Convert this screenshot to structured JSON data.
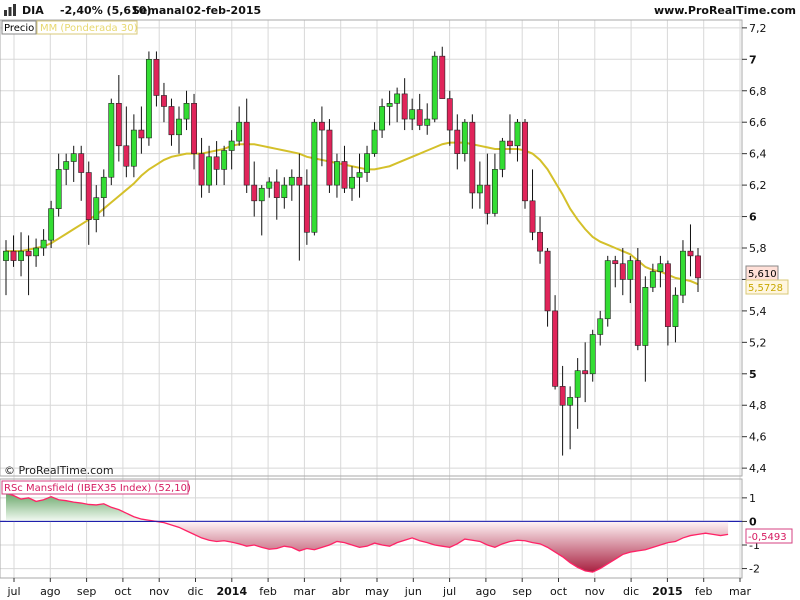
{
  "header": {
    "symbol": "DIA",
    "change": "-2,40% (5,610)",
    "timeframe": "Semanal",
    "date": "02-feb-2015",
    "site": "www.ProRealTime.com"
  },
  "price_panel": {
    "label_precio": "Precio",
    "label_ma": "MM (Ponderada 30)",
    "copyright": "© ProRealTime.com",
    "last_price": "5,610",
    "last_ma": "5,5728"
  },
  "rsc_panel": {
    "label": "RSc Mansfield (IBEX35 Index) (52,10)",
    "last_value": "-0,5493"
  },
  "colors": {
    "up": "#33dd33",
    "down": "#e0245a",
    "ma": "#d4c02a",
    "rsc_line": "#ff2266",
    "grid": "#d8d8d8",
    "zero_line": "#1818aa"
  },
  "chart_data": [
    {
      "type": "candlestick",
      "ylim": [
        4.35,
        7.25
      ],
      "y_ticks": [
        "7,2",
        "7",
        "6,8",
        "6,6",
        "6,4",
        "6,2",
        "6",
        "5,8",
        "5,6",
        "5,4",
        "5,2",
        "5",
        "4,8",
        "4,6",
        "4,4"
      ],
      "x_ticks": [
        "jul",
        "ago",
        "sep",
        "oct",
        "nov",
        "dic",
        "2014",
        "feb",
        "mar",
        "abr",
        "may",
        "jun",
        "jul",
        "ago",
        "sep",
        "oct",
        "nov",
        "dic",
        "2015",
        "feb",
        "mar"
      ],
      "series": [
        {
          "name": "DIA",
          "ohlc": [
            [
              5.72,
              5.85,
              5.5,
              5.78
            ],
            [
              5.78,
              5.88,
              5.68,
              5.72
            ],
            [
              5.72,
              5.9,
              5.62,
              5.78
            ],
            [
              5.78,
              5.88,
              5.5,
              5.75
            ],
            [
              5.75,
              5.86,
              5.68,
              5.8
            ],
            [
              5.8,
              5.92,
              5.75,
              5.85
            ],
            [
              5.85,
              6.1,
              5.8,
              6.05
            ],
            [
              6.05,
              6.4,
              6.0,
              6.3
            ],
            [
              6.3,
              6.4,
              6.2,
              6.35
            ],
            [
              6.35,
              6.45,
              6.22,
              6.4
            ],
            [
              6.4,
              6.45,
              6.1,
              6.28
            ],
            [
              6.28,
              6.35,
              5.82,
              5.98
            ],
            [
              5.98,
              6.2,
              5.9,
              6.12
            ],
            [
              6.12,
              6.3,
              6.0,
              6.25
            ],
            [
              6.25,
              6.75,
              6.2,
              6.72
            ],
            [
              6.72,
              6.9,
              6.35,
              6.45
            ],
            [
              6.45,
              6.7,
              6.25,
              6.32
            ],
            [
              6.32,
              6.65,
              6.25,
              6.55
            ],
            [
              6.55,
              6.7,
              6.4,
              6.5
            ],
            [
              6.5,
              7.05,
              6.45,
              7.0
            ],
            [
              7.0,
              7.05,
              6.7,
              6.77
            ],
            [
              6.77,
              6.85,
              6.6,
              6.7
            ],
            [
              6.7,
              6.75,
              6.45,
              6.52
            ],
            [
              6.52,
              6.7,
              6.4,
              6.62
            ],
            [
              6.62,
              6.8,
              6.55,
              6.72
            ],
            [
              6.72,
              6.78,
              6.3,
              6.4
            ],
            [
              6.4,
              6.5,
              6.12,
              6.2
            ],
            [
              6.2,
              6.45,
              6.15,
              6.38
            ],
            [
              6.38,
              6.48,
              6.2,
              6.3
            ],
            [
              6.3,
              6.45,
              6.2,
              6.42
            ],
            [
              6.42,
              6.55,
              6.3,
              6.48
            ],
            [
              6.48,
              6.7,
              6.45,
              6.6
            ],
            [
              6.6,
              6.75,
              6.15,
              6.2
            ],
            [
              6.2,
              6.35,
              6.0,
              6.1
            ],
            [
              6.1,
              6.2,
              5.88,
              6.18
            ],
            [
              6.18,
              6.25,
              6.12,
              6.22
            ],
            [
              6.22,
              6.3,
              5.98,
              6.12
            ],
            [
              6.12,
              6.25,
              6.05,
              6.2
            ],
            [
              6.2,
              6.3,
              6.1,
              6.25
            ],
            [
              6.25,
              6.4,
              5.72,
              6.2
            ],
            [
              6.2,
              6.3,
              5.82,
              5.9
            ],
            [
              5.9,
              6.62,
              5.88,
              6.6
            ],
            [
              6.6,
              6.7,
              6.32,
              6.55
            ],
            [
              6.55,
              6.62,
              6.15,
              6.2
            ],
            [
              6.2,
              6.4,
              6.12,
              6.35
            ],
            [
              6.35,
              6.45,
              6.15,
              6.18
            ],
            [
              6.18,
              6.32,
              6.1,
              6.25
            ],
            [
              6.25,
              6.4,
              6.12,
              6.28
            ],
            [
              6.28,
              6.45,
              6.22,
              6.4
            ],
            [
              6.4,
              6.6,
              6.38,
              6.55
            ],
            [
              6.55,
              6.75,
              6.5,
              6.7
            ],
            [
              6.7,
              6.8,
              6.58,
              6.72
            ],
            [
              6.72,
              6.82,
              6.6,
              6.78
            ],
            [
              6.78,
              6.88,
              6.55,
              6.62
            ],
            [
              6.62,
              6.75,
              6.55,
              6.68
            ],
            [
              6.68,
              6.78,
              6.55,
              6.58
            ],
            [
              6.58,
              6.72,
              6.52,
              6.62
            ],
            [
              6.62,
              7.05,
              6.6,
              7.02
            ],
            [
              7.02,
              7.08,
              6.75,
              6.75
            ],
            [
              6.75,
              6.8,
              6.45,
              6.55
            ],
            [
              6.55,
              6.65,
              6.3,
              6.4
            ],
            [
              6.4,
              6.62,
              6.35,
              6.6
            ],
            [
              6.6,
              6.65,
              6.05,
              6.15
            ],
            [
              6.15,
              6.35,
              6.05,
              6.2
            ],
            [
              6.2,
              6.4,
              5.95,
              6.02
            ],
            [
              6.02,
              6.4,
              6.0,
              6.3
            ],
            [
              6.3,
              6.5,
              6.25,
              6.48
            ],
            [
              6.48,
              6.65,
              6.4,
              6.45
            ],
            [
              6.45,
              6.62,
              6.35,
              6.6
            ],
            [
              6.6,
              6.62,
              6.05,
              6.1
            ],
            [
              6.1,
              6.3,
              5.85,
              5.9
            ],
            [
              5.9,
              6.0,
              5.7,
              5.78
            ],
            [
              5.78,
              5.8,
              5.3,
              5.4
            ],
            [
              5.4,
              5.5,
              4.9,
              4.92
            ],
            [
              4.92,
              5.05,
              4.48,
              4.8
            ],
            [
              4.8,
              4.92,
              4.52,
              4.85
            ],
            [
              4.85,
              5.1,
              4.65,
              5.02
            ],
            [
              5.02,
              5.2,
              4.82,
              5.0
            ],
            [
              5.0,
              5.28,
              4.95,
              5.25
            ],
            [
              5.25,
              5.4,
              5.18,
              5.35
            ],
            [
              5.35,
              5.75,
              5.3,
              5.72
            ],
            [
              5.72,
              5.75,
              5.55,
              5.7
            ],
            [
              5.7,
              5.8,
              5.5,
              5.6
            ],
            [
              5.6,
              5.75,
              5.45,
              5.72
            ],
            [
              5.72,
              5.8,
              5.15,
              5.18
            ],
            [
              5.18,
              5.62,
              4.95,
              5.55
            ],
            [
              5.55,
              5.7,
              5.52,
              5.65
            ],
            [
              5.65,
              5.75,
              5.55,
              5.7
            ],
            [
              5.7,
              5.72,
              5.18,
              5.3
            ],
            [
              5.3,
              5.55,
              5.2,
              5.5
            ],
            [
              5.5,
              5.85,
              5.45,
              5.78
            ],
            [
              5.78,
              5.95,
              5.62,
              5.75
            ],
            [
              5.75,
              5.8,
              5.52,
              5.61
            ]
          ]
        },
        {
          "name": "MM (Ponderada 30)",
          "values": [
            5.78,
            5.78,
            5.78,
            5.79,
            5.8,
            5.81,
            5.83,
            5.86,
            5.89,
            5.92,
            5.95,
            5.98,
            6.01,
            6.05,
            6.09,
            6.13,
            6.17,
            6.21,
            6.26,
            6.3,
            6.33,
            6.36,
            6.38,
            6.39,
            6.4,
            6.4,
            6.4,
            6.41,
            6.42,
            6.43,
            6.45,
            6.46,
            6.46,
            6.46,
            6.45,
            6.44,
            6.43,
            6.42,
            6.41,
            6.4,
            6.38,
            6.37,
            6.36,
            6.35,
            6.34,
            6.33,
            6.32,
            6.31,
            6.3,
            6.3,
            6.31,
            6.32,
            6.34,
            6.36,
            6.38,
            6.4,
            6.42,
            6.44,
            6.46,
            6.47,
            6.47,
            6.47,
            6.46,
            6.45,
            6.44,
            6.43,
            6.43,
            6.43,
            6.43,
            6.42,
            6.4,
            6.36,
            6.3,
            6.22,
            6.14,
            6.05,
            5.98,
            5.92,
            5.87,
            5.84,
            5.82,
            5.8,
            5.78,
            5.76,
            5.72,
            5.68,
            5.66,
            5.65,
            5.63,
            5.61,
            5.6,
            5.59,
            5.57
          ]
        }
      ]
    },
    {
      "type": "area",
      "title": "RSc Mansfield (IBEX35 Index) (52,10)",
      "ylim": [
        -2.4,
        1.8
      ],
      "y_ticks": [
        "1",
        "0",
        "-1",
        "-2"
      ],
      "series": [
        {
          "name": "RSc Mansfield (IBEX35 Index) (52,10)",
          "values": [
            1.2,
            1.1,
            0.95,
            1.0,
            0.85,
            0.92,
            1.05,
            0.92,
            0.88,
            0.82,
            0.78,
            0.72,
            0.7,
            0.75,
            0.6,
            0.5,
            0.35,
            0.2,
            0.1,
            0.05,
            0.0,
            -0.05,
            -0.15,
            -0.25,
            -0.4,
            -0.55,
            -0.7,
            -0.8,
            -0.85,
            -0.82,
            -0.88,
            -0.95,
            -1.05,
            -1.0,
            -1.1,
            -1.18,
            -1.15,
            -1.05,
            -1.1,
            -1.25,
            -1.15,
            -1.2,
            -1.1,
            -1.0,
            -0.85,
            -0.9,
            -1.0,
            -1.1,
            -1.05,
            -0.92,
            -1.0,
            -1.05,
            -0.9,
            -0.8,
            -0.7,
            -0.82,
            -0.9,
            -1.0,
            -1.05,
            -1.1,
            -0.95,
            -0.75,
            -0.8,
            -0.85,
            -1.0,
            -1.1,
            -0.95,
            -0.85,
            -0.8,
            -0.82,
            -0.9,
            -0.95,
            -1.1,
            -1.3,
            -1.5,
            -1.75,
            -1.95,
            -2.1,
            -2.15,
            -2.0,
            -1.8,
            -1.6,
            -1.4,
            -1.3,
            -1.25,
            -1.2,
            -1.1,
            -1.0,
            -0.9,
            -0.85,
            -0.7,
            -0.6,
            -0.55,
            -0.5,
            -0.55,
            -0.6,
            -0.55
          ]
        }
      ]
    }
  ]
}
